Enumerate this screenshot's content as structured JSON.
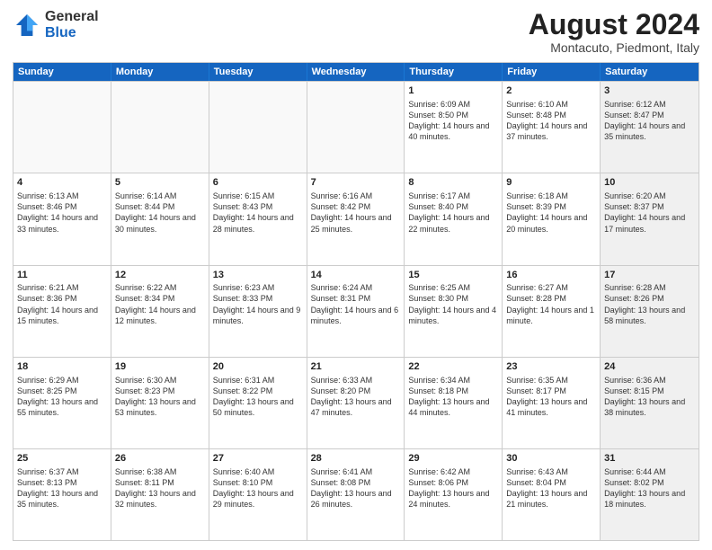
{
  "logo": {
    "general": "General",
    "blue": "Blue"
  },
  "title": "August 2024",
  "location": "Montacuto, Piedmont, Italy",
  "days": [
    "Sunday",
    "Monday",
    "Tuesday",
    "Wednesday",
    "Thursday",
    "Friday",
    "Saturday"
  ],
  "rows": [
    [
      {
        "num": "",
        "text": "",
        "empty": true
      },
      {
        "num": "",
        "text": "",
        "empty": true
      },
      {
        "num": "",
        "text": "",
        "empty": true
      },
      {
        "num": "",
        "text": "",
        "empty": true
      },
      {
        "num": "1",
        "text": "Sunrise: 6:09 AM\nSunset: 8:50 PM\nDaylight: 14 hours and 40 minutes."
      },
      {
        "num": "2",
        "text": "Sunrise: 6:10 AM\nSunset: 8:48 PM\nDaylight: 14 hours and 37 minutes."
      },
      {
        "num": "3",
        "text": "Sunrise: 6:12 AM\nSunset: 8:47 PM\nDaylight: 14 hours and 35 minutes.",
        "shaded": true
      }
    ],
    [
      {
        "num": "4",
        "text": "Sunrise: 6:13 AM\nSunset: 8:46 PM\nDaylight: 14 hours and 33 minutes."
      },
      {
        "num": "5",
        "text": "Sunrise: 6:14 AM\nSunset: 8:44 PM\nDaylight: 14 hours and 30 minutes."
      },
      {
        "num": "6",
        "text": "Sunrise: 6:15 AM\nSunset: 8:43 PM\nDaylight: 14 hours and 28 minutes."
      },
      {
        "num": "7",
        "text": "Sunrise: 6:16 AM\nSunset: 8:42 PM\nDaylight: 14 hours and 25 minutes."
      },
      {
        "num": "8",
        "text": "Sunrise: 6:17 AM\nSunset: 8:40 PM\nDaylight: 14 hours and 22 minutes."
      },
      {
        "num": "9",
        "text": "Sunrise: 6:18 AM\nSunset: 8:39 PM\nDaylight: 14 hours and 20 minutes."
      },
      {
        "num": "10",
        "text": "Sunrise: 6:20 AM\nSunset: 8:37 PM\nDaylight: 14 hours and 17 minutes.",
        "shaded": true
      }
    ],
    [
      {
        "num": "11",
        "text": "Sunrise: 6:21 AM\nSunset: 8:36 PM\nDaylight: 14 hours and 15 minutes."
      },
      {
        "num": "12",
        "text": "Sunrise: 6:22 AM\nSunset: 8:34 PM\nDaylight: 14 hours and 12 minutes."
      },
      {
        "num": "13",
        "text": "Sunrise: 6:23 AM\nSunset: 8:33 PM\nDaylight: 14 hours and 9 minutes."
      },
      {
        "num": "14",
        "text": "Sunrise: 6:24 AM\nSunset: 8:31 PM\nDaylight: 14 hours and 6 minutes."
      },
      {
        "num": "15",
        "text": "Sunrise: 6:25 AM\nSunset: 8:30 PM\nDaylight: 14 hours and 4 minutes."
      },
      {
        "num": "16",
        "text": "Sunrise: 6:27 AM\nSunset: 8:28 PM\nDaylight: 14 hours and 1 minute."
      },
      {
        "num": "17",
        "text": "Sunrise: 6:28 AM\nSunset: 8:26 PM\nDaylight: 13 hours and 58 minutes.",
        "shaded": true
      }
    ],
    [
      {
        "num": "18",
        "text": "Sunrise: 6:29 AM\nSunset: 8:25 PM\nDaylight: 13 hours and 55 minutes."
      },
      {
        "num": "19",
        "text": "Sunrise: 6:30 AM\nSunset: 8:23 PM\nDaylight: 13 hours and 53 minutes."
      },
      {
        "num": "20",
        "text": "Sunrise: 6:31 AM\nSunset: 8:22 PM\nDaylight: 13 hours and 50 minutes."
      },
      {
        "num": "21",
        "text": "Sunrise: 6:33 AM\nSunset: 8:20 PM\nDaylight: 13 hours and 47 minutes."
      },
      {
        "num": "22",
        "text": "Sunrise: 6:34 AM\nSunset: 8:18 PM\nDaylight: 13 hours and 44 minutes."
      },
      {
        "num": "23",
        "text": "Sunrise: 6:35 AM\nSunset: 8:17 PM\nDaylight: 13 hours and 41 minutes."
      },
      {
        "num": "24",
        "text": "Sunrise: 6:36 AM\nSunset: 8:15 PM\nDaylight: 13 hours and 38 minutes.",
        "shaded": true
      }
    ],
    [
      {
        "num": "25",
        "text": "Sunrise: 6:37 AM\nSunset: 8:13 PM\nDaylight: 13 hours and 35 minutes."
      },
      {
        "num": "26",
        "text": "Sunrise: 6:38 AM\nSunset: 8:11 PM\nDaylight: 13 hours and 32 minutes."
      },
      {
        "num": "27",
        "text": "Sunrise: 6:40 AM\nSunset: 8:10 PM\nDaylight: 13 hours and 29 minutes."
      },
      {
        "num": "28",
        "text": "Sunrise: 6:41 AM\nSunset: 8:08 PM\nDaylight: 13 hours and 26 minutes."
      },
      {
        "num": "29",
        "text": "Sunrise: 6:42 AM\nSunset: 8:06 PM\nDaylight: 13 hours and 24 minutes."
      },
      {
        "num": "30",
        "text": "Sunrise: 6:43 AM\nSunset: 8:04 PM\nDaylight: 13 hours and 21 minutes."
      },
      {
        "num": "31",
        "text": "Sunrise: 6:44 AM\nSunset: 8:02 PM\nDaylight: 13 hours and 18 minutes.",
        "shaded": true
      }
    ]
  ]
}
